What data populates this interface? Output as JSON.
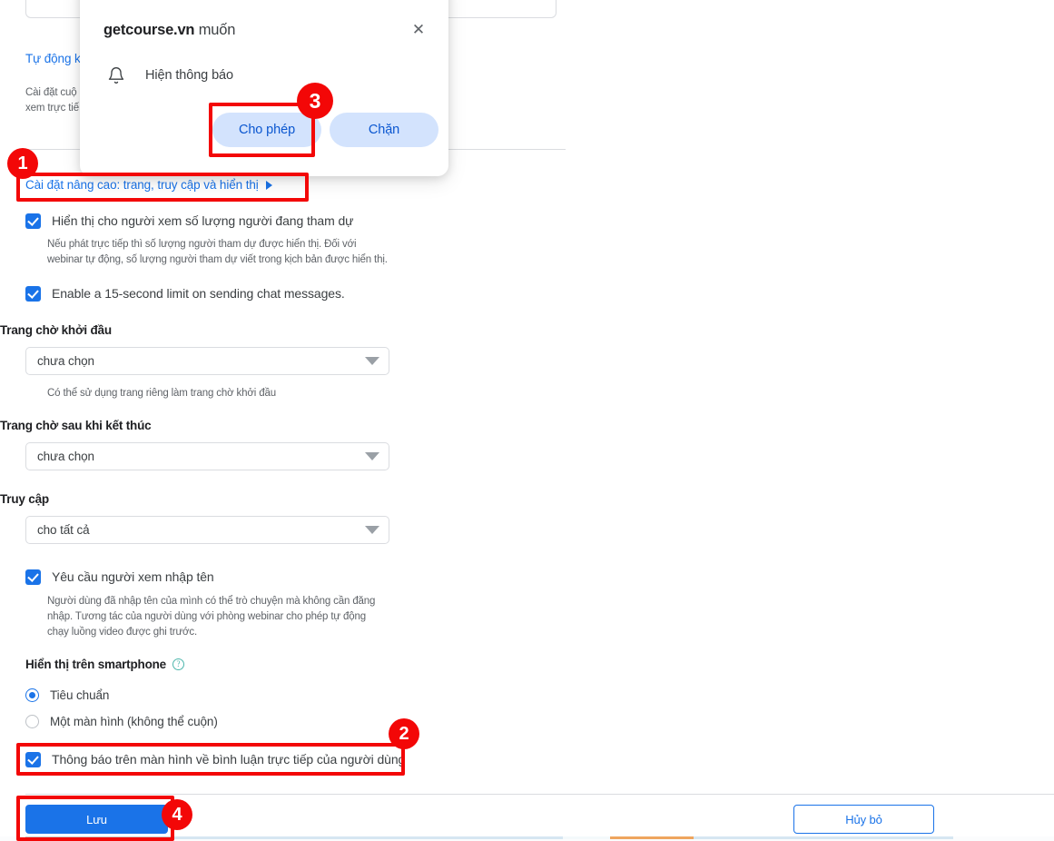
{
  "dialog": {
    "origin": "getcourse.vn",
    "title_suffix": " muốn",
    "permission_row": "Hiện thông báo",
    "allow_label": "Cho phép",
    "block_label": "Chặn",
    "close_icon": "close-icon",
    "bell_icon": "bell-icon",
    "button_bg": "#d3e3fd",
    "button_text_color": "#0b57d0"
  },
  "form": {
    "auto_link": "Tự động kì",
    "auto_desc": "Cài đặt cuộ                                              ện cho tất cả người\nxem trực tiế",
    "advanced_link": "Cài đặt nâng cao: trang, truy cập và hiển thị",
    "advanced_caret": "caret-right-icon",
    "checkbox_viewer_count": {
      "label": "Hiển thị cho người xem số lượng người đang tham dự",
      "checked": true,
      "hint": "Nếu phát trực tiếp thì số lượng người tham dự được hiển thị. Đối với webinar tự động, số lượng người tham dự viết trong kịch bản được hiển thị."
    },
    "checkbox_chat_limit": {
      "label": "Enable a 15-second limit on sending chat messages.",
      "checked": true
    },
    "field_start_page": {
      "label": "Trang chờ khởi đầu",
      "value": "chưa chọn",
      "hint": "Có thể sử dụng trang riêng làm trang chờ khởi đầu"
    },
    "field_end_page": {
      "label": "Trang chờ sau khi kết thúc",
      "value": "chưa chọn"
    },
    "field_access": {
      "label": "Truy cập",
      "value": "cho tất cả"
    },
    "checkbox_require_name": {
      "label": "Yêu cầu người xem nhập tên",
      "checked": true,
      "hint": "Người dùng đã nhập tên của mình có thể trò chuyện mà không cần đăng nhập. Tương tác của người dùng với phòng webinar cho phép tự động chạy luồng video được ghi trước."
    },
    "smartphone_section": {
      "label": "Hiển thị trên smartphone",
      "help_icon": "help-circle-icon",
      "options": [
        {
          "label": "Tiêu chuẩn",
          "selected": true
        },
        {
          "label": "Một màn hình (không thể cuộn)",
          "selected": false
        }
      ]
    },
    "checkbox_onscreen_notice": {
      "label": "Thông báo trên màn hình về bình luận trực tiếp của người dùng",
      "checked": true
    },
    "save_label": "Lưu",
    "cancel_label": "Hủy bỏ",
    "accent_color": "#1a73e8"
  },
  "annotations": {
    "color": "#f30707",
    "markers": [
      {
        "number": "1",
        "target": "advanced-settings-link"
      },
      {
        "number": "2",
        "target": "onscreen-notice-checkbox"
      },
      {
        "number": "3",
        "target": "dialog-allow-button"
      },
      {
        "number": "4",
        "target": "save-button"
      }
    ]
  }
}
